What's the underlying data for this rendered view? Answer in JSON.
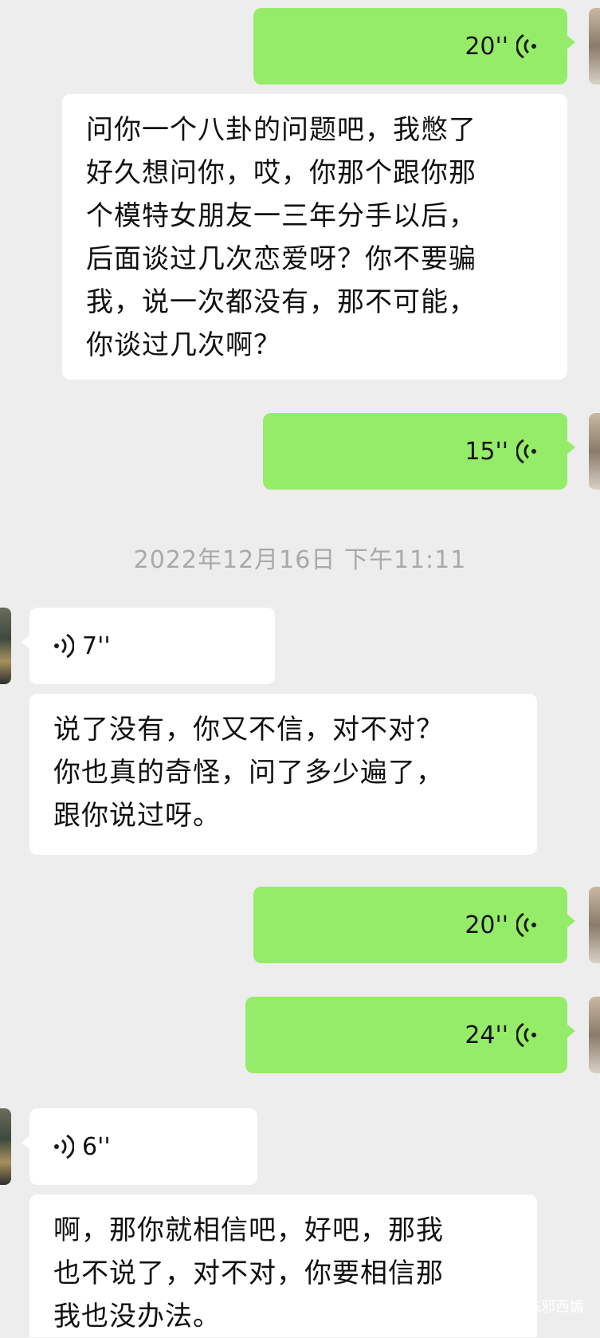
{
  "messages": {
    "m1": {
      "duration": "20''"
    },
    "m2": {
      "text": "问你一个八卦的问题吧，我憋了\n好久想问你，哎，你那个跟你那\n个模特女朋友一三年分手以后，\n后面谈过几次恋爱呀？你不要骗\n我，说一次都没有，那不可能，\n你谈过几次啊？"
    },
    "m3": {
      "duration": "15''"
    },
    "timestamp": "2022年12月16日 下午11:11",
    "m4": {
      "duration": "7''"
    },
    "m5": {
      "text": "说了没有，你又不信，对不对？\n你也真的奇怪，问了多少遍了，\n跟你说过呀。"
    },
    "m6": {
      "duration": "20''"
    },
    "m7": {
      "duration": "24''"
    },
    "m8": {
      "duration": "6''"
    },
    "m9": {
      "text": "啊，那你就相信吧，好吧，那我\n也不说了，对不对，你要相信那\n我也没办法。"
    }
  },
  "watermark": {
    "text": "东邪西媚",
    "icon": "wechat-icon"
  },
  "colors": {
    "background": "#ededed",
    "outgoing": "#95ec69",
    "incoming": "#ffffff",
    "timestamp": "#a9a9a9"
  }
}
